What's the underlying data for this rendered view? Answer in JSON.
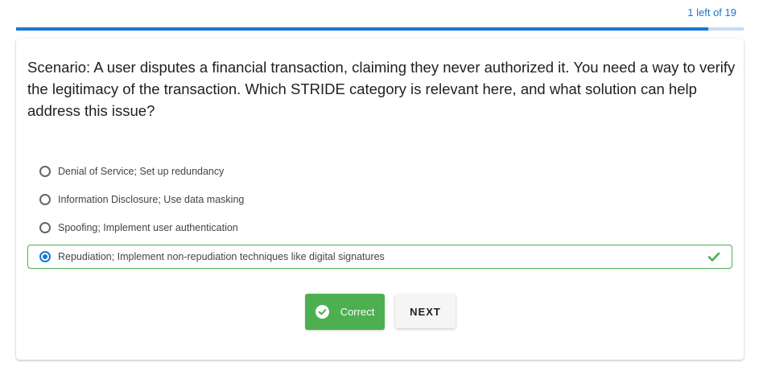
{
  "progress": {
    "label": "1 left of 19",
    "fraction": 0.951
  },
  "question": {
    "text": "Scenario: A user disputes a financial transaction, claiming they never authorized it. You need a way to verify the legitimacy of the transaction. Which STRIDE category is relevant here, and what solution can help address this issue?"
  },
  "options": [
    {
      "label": "Denial of Service; Set up redundancy",
      "selected": false
    },
    {
      "label": "Information Disclosure; Use data masking",
      "selected": false
    },
    {
      "label": "Spoofing; Implement user authentication",
      "selected": false
    },
    {
      "label": "Repudiation; Implement non-repudiation techniques like digital signatures",
      "selected": true,
      "correct": true
    }
  ],
  "feedback": {
    "label": "Correct",
    "icon": "check-circle-icon",
    "color": "#4caf50"
  },
  "actions": {
    "next_label": "NEXT"
  },
  "colors": {
    "accent": "#1976d2",
    "success": "#4caf50"
  }
}
